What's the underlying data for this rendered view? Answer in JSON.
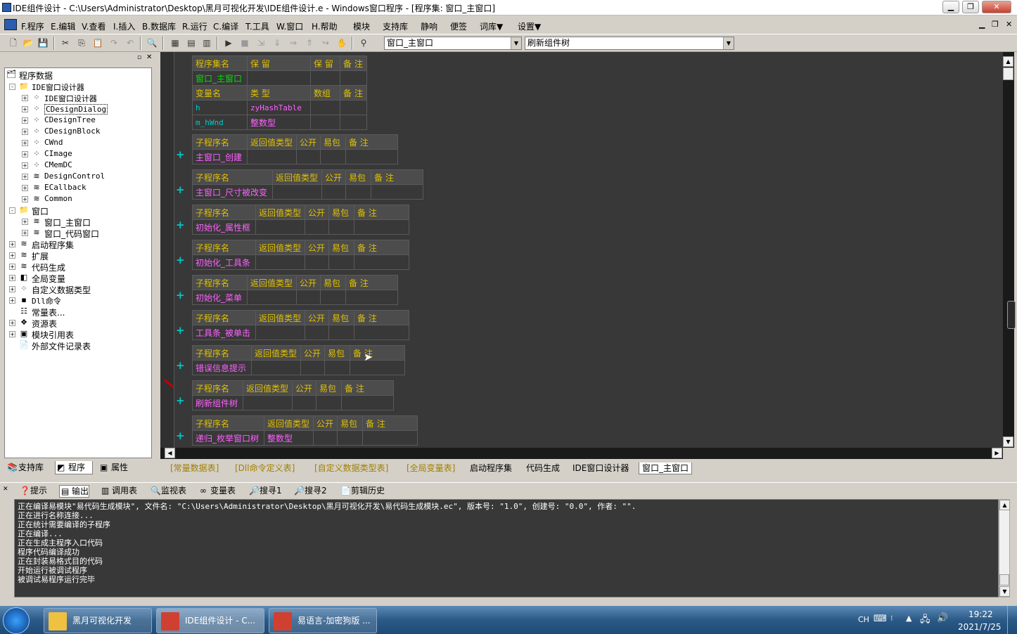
{
  "window": {
    "title": "IDE组件设计 - C:\\Users\\Administrator\\Desktop\\黑月可视化开发\\IDE组件设计.e - Windows窗口程序 - [程序集: 窗口_主窗口]"
  },
  "menu": [
    "F.程序",
    "E.编辑",
    "V.查看",
    "I.插入",
    "B.数据库",
    "R.运行",
    "C.编译",
    "T.工具",
    "W.窗口",
    "H.帮助",
    "模块",
    "支持库",
    "静响",
    "便签",
    "词库▼",
    "设置▼"
  ],
  "toolbar": {
    "combo1": "窗口_主窗口",
    "combo2": "刷新组件树"
  },
  "tree": {
    "root": "程序数据",
    "items": [
      {
        "label": "IDE窗口设计器",
        "icon": "folder",
        "level": 1,
        "exp": "-"
      },
      {
        "label": "IDE窗口设计器",
        "icon": "class",
        "level": 2,
        "exp": "+"
      },
      {
        "label": "CDesignDialog",
        "icon": "class",
        "level": 2,
        "exp": "+",
        "selected": true
      },
      {
        "label": "CDesignTree",
        "icon": "class",
        "level": 2,
        "exp": "+"
      },
      {
        "label": "CDesignBlock",
        "icon": "class",
        "level": 2,
        "exp": "+"
      },
      {
        "label": "CWnd",
        "icon": "class",
        "level": 2,
        "exp": "+"
      },
      {
        "label": "CImage",
        "icon": "class",
        "level": 2,
        "exp": "+"
      },
      {
        "label": "CMemDC",
        "icon": "class",
        "level": 2,
        "exp": "+"
      },
      {
        "label": "DesignControl",
        "icon": "module",
        "level": 2,
        "exp": "+"
      },
      {
        "label": "ECallback",
        "icon": "module",
        "level": 2,
        "exp": "+"
      },
      {
        "label": "Common",
        "icon": "module",
        "level": 2,
        "exp": "+"
      },
      {
        "label": "窗口",
        "icon": "folder",
        "level": 1,
        "exp": "-"
      },
      {
        "label": "窗口_主窗口",
        "icon": "module",
        "level": 2,
        "exp": "+"
      },
      {
        "label": "窗口_代码窗口",
        "icon": "module",
        "level": 2,
        "exp": "+"
      },
      {
        "label": "启动程序集",
        "icon": "module",
        "level": 1,
        "exp": "+"
      },
      {
        "label": "扩展",
        "icon": "module",
        "level": 1,
        "exp": "+"
      },
      {
        "label": "代码生成",
        "icon": "module",
        "level": 1,
        "exp": "+"
      },
      {
        "label": "全局变量",
        "icon": "var",
        "level": 1,
        "exp": "+"
      },
      {
        "label": "自定义数据类型",
        "icon": "class",
        "level": 1,
        "exp": "+"
      },
      {
        "label": "Dll命令",
        "icon": "dll",
        "level": 1,
        "exp": "+"
      },
      {
        "label": "常量表...",
        "icon": "const",
        "level": 1,
        "exp": ""
      },
      {
        "label": "资源表",
        "icon": "res",
        "level": 1,
        "exp": "+"
      },
      {
        "label": "模块引用表",
        "icon": "mod",
        "level": 1,
        "exp": "+"
      },
      {
        "label": "外部文件记录表",
        "icon": "file",
        "level": 1,
        "exp": ""
      }
    ]
  },
  "lefttabs": [
    "支持库",
    "程序",
    "属性"
  ],
  "assembly": {
    "h1": [
      "程序集名",
      "保 留",
      "保 留",
      "备 注"
    ],
    "r1": [
      "窗口_主窗口",
      "",
      "",
      ""
    ],
    "h2": [
      "变量名",
      "类 型",
      "数组",
      "备 注"
    ],
    "vars": [
      [
        "h",
        "zyHashTable",
        "",
        ""
      ],
      [
        "m_hWnd",
        "整数型",
        "",
        ""
      ]
    ]
  },
  "sub_header": [
    "子程序名",
    "返回值类型",
    "公开",
    "易包",
    "备 注"
  ],
  "subs": [
    {
      "name": "主窗口_创建",
      "ret": ""
    },
    {
      "name": "主窗口_尺寸被改变",
      "ret": ""
    },
    {
      "name": "初始化_属性框",
      "ret": ""
    },
    {
      "name": "初始化_工具条",
      "ret": ""
    },
    {
      "name": "初始化_菜单",
      "ret": ""
    },
    {
      "name": "工具条_被单击",
      "ret": ""
    },
    {
      "name": "错误信息提示",
      "ret": ""
    },
    {
      "name": "刷新组件树",
      "ret": ""
    },
    {
      "name": "递归_枚举窗口树",
      "ret": "整数型"
    }
  ],
  "filetabs": [
    "[常量数据表]",
    "[Dll命令定义表]",
    "[自定义数据类型表]",
    "[全局变量表]",
    "启动程序集",
    "代码生成",
    "IDE窗口设计器",
    "窗口_主窗口"
  ],
  "outtabs": [
    "提示",
    "输出",
    "调用表",
    "监视表",
    "变量表",
    "搜寻1",
    "搜寻2",
    "剪辑历史"
  ],
  "output": [
    "正在编译易模块\"易代码生成模块\", 文件名: \"C:\\Users\\Administrator\\Desktop\\黑月可视化开发\\易代码生成模块.ec\", 版本号: \"1.0\", 创建号: \"0.0\", 作者: \"\".",
    "正在进行名称连接...",
    "正在统计需要编译的子程序",
    "正在编译...",
    "正在生成主程序入口代码",
    "程序代码编译成功",
    "正在封装易格式目的代码",
    "开始运行被调试程序",
    "被调试易程序运行完毕"
  ],
  "taskbar": {
    "items": [
      "黑月可视化开发",
      "IDE组件设计 - C...",
      "易语言-加密狗版 ..."
    ],
    "lang": "CH",
    "time": "19:22",
    "date": "2021/7/25"
  },
  "colors": {
    "editor_bg": "#383838",
    "header_text": "#e0c000",
    "sub_name": "#ff60ff",
    "assembly_name": "#00e000",
    "type_text": "#ff60ff",
    "var_name": "#00c8c8"
  }
}
